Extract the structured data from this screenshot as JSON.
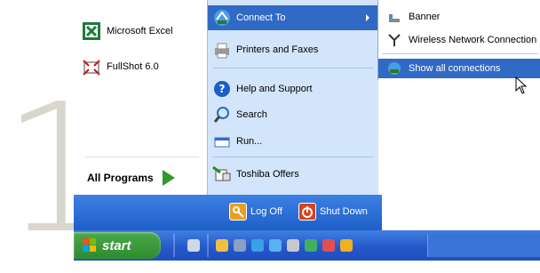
{
  "step_number": "1",
  "left_pane": {
    "programs": [
      {
        "label": "Microsoft Excel",
        "icon": "excel-icon"
      },
      {
        "label": "FullShot 6.0",
        "icon": "fullshot-icon"
      }
    ],
    "all_programs_label": "All Programs"
  },
  "right_pane": {
    "items": [
      {
        "label": "Connect To",
        "icon": "network-connect-icon"
      },
      {
        "label": "Printers and Faxes",
        "icon": "printer-icon"
      },
      {
        "label": "Help and Support",
        "icon": "help-icon"
      },
      {
        "label": "Search",
        "icon": "search-icon"
      },
      {
        "label": "Run...",
        "icon": "run-icon"
      },
      {
        "label": "Toshiba Offers",
        "icon": "toshiba-offers-icon"
      }
    ]
  },
  "submenu": {
    "items": [
      {
        "label": "Banner",
        "icon": "modem-icon"
      },
      {
        "label": "Wireless Network Connection",
        "icon": "wireless-antenna-icon"
      },
      {
        "label": "Show all connections",
        "icon": "network-connections-icon"
      }
    ]
  },
  "bottom_bar": {
    "log_off_label": "Log Off",
    "shut_down_label": "Shut Down"
  },
  "taskbar": {
    "start_label": "start",
    "quick_launch": [
      "pencil-icon",
      "folder-icon",
      "printer-icon",
      "ie-icon",
      "browser-icon",
      "tools-icon",
      "media-icon",
      "player-icon",
      "star-icon"
    ]
  },
  "colors": {
    "highlight": "#316ac5",
    "menu_blue": "#d3e5fa",
    "taskbar_blue": "#2456c9",
    "start_green": "#3a9a3a"
  }
}
